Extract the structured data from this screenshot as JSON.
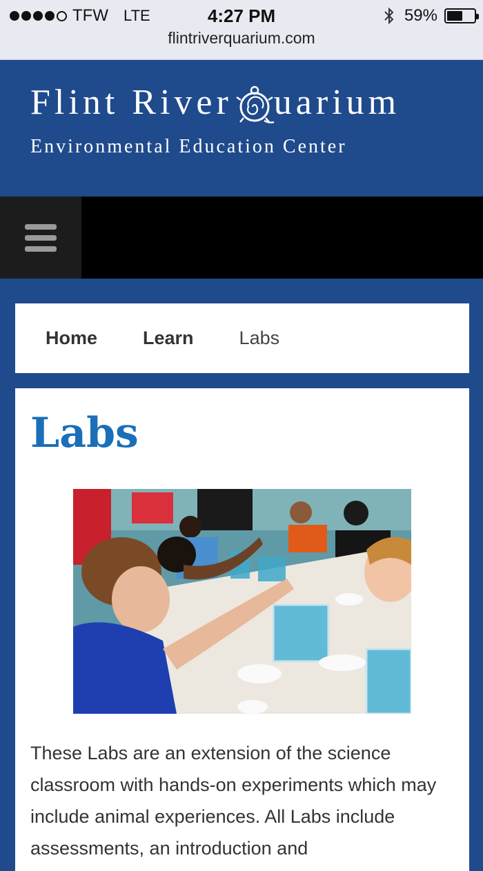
{
  "status_bar": {
    "carrier": "TFW",
    "network": "LTE",
    "time": "4:27 PM",
    "battery_percent": "59%",
    "battery_level": 0.59,
    "signal_bars_filled": 4,
    "signal_bars_total": 5
  },
  "browser": {
    "url": "flintriverquarium.com"
  },
  "header": {
    "title_part1": "Flint River",
    "title_part2": "uarium",
    "subtitle": "Environmental Education Center",
    "brand_color": "#1f4a8c"
  },
  "nav": {
    "menu_icon": "hamburger-menu-icon"
  },
  "breadcrumb": {
    "items": [
      {
        "label": "Home"
      },
      {
        "label": "Learn"
      },
      {
        "label": "Labs"
      }
    ]
  },
  "content": {
    "title": "Labs",
    "title_color": "#1a6fb8",
    "body": "These Labs are an extension of the science classroom with hands-on experiments which may include animal experiences. All Labs include assessments, an introduction and"
  }
}
